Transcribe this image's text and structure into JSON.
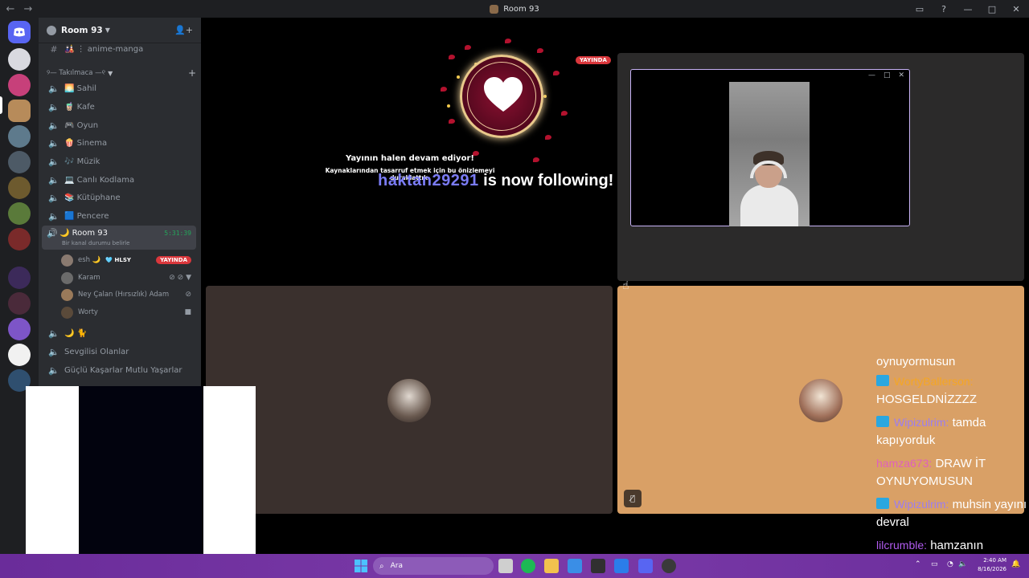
{
  "window": {
    "title": "Room 93",
    "back": "←",
    "forward": "→",
    "controls": {
      "inbox": "▭",
      "help": "?",
      "minimize": "—",
      "maximize": "□",
      "close": "✕"
    }
  },
  "server": {
    "name": "Room 93",
    "top_channel": "🎎 ⋮ anime-manga",
    "category": "୨— Takılmaca —୧",
    "channels": [
      "🌅 Sahil",
      "🧋 Kafe",
      "🎮 Oyun",
      "🍿 Sinema",
      "🎶 Müzik",
      "💻 Canlı Kodlama",
      "📚 Kütüphane",
      "🟦 Pencere"
    ],
    "active_channel": {
      "name": "🌙 Room 93",
      "status": "Bir kanal durumu belirle",
      "timer": "5:31:39"
    },
    "voice_users": [
      {
        "name": "esh 🌙",
        "tag": "🩵 HLSY",
        "badge": "YAYINDA"
      },
      {
        "name": "Karam",
        "icons": "⊘ ⊘ ▼"
      },
      {
        "name": "Ney Çalan (Hırsızlık) Adam",
        "icons": "⊘"
      },
      {
        "name": "Worty",
        "icons": "■"
      }
    ],
    "more_channels": [
      "🌙 🐈",
      "Sevgilisi Olanlar",
      "Güçlü Kaşarlar Mutlu Yaşarlar"
    ]
  },
  "stream": {
    "live_badge": "YAYINDA",
    "paused_title": "Yayının halen devam ediyor!",
    "paused_desc": "Kaynaklarından tasarruf etmek için bu önizlemeyi duraklattık.",
    "follow_user": "haktan29291",
    "follow_text": " is now following!"
  },
  "pip": {
    "minimize": "—",
    "expand": "□",
    "close": "✕"
  },
  "chat": [
    {
      "user": "",
      "text": "oynuyormusun",
      "user_color": "#f5b041"
    },
    {
      "user": "WortyBallerson:",
      "text": "HOSGELDNİZZZZ",
      "user_color": "#f5a623",
      "badge": true
    },
    {
      "user": "Wipizulrim:",
      "text": "tamda kapıyorduk",
      "user_color": "#9b7df2",
      "badge": true
    },
    {
      "user": "hamza673:",
      "text": "DRAW İT OYNUYOMUSUN",
      "user_color": "#e05fbd",
      "badge": false
    },
    {
      "user": "Wipizulrim:",
      "text": "muhsin yayını devral",
      "user_color": "#9b7df2",
      "badge": true
    },
    {
      "user": "lilcrumble:",
      "text": "hamzanın heyecanı",
      "user_color": "#b15bf0",
      "badge": false
    }
  ],
  "taskbar": {
    "search_placeholder": "Ara",
    "time": "2:40 AM",
    "date": "8/16/2026"
  },
  "colors": {
    "accent": "#5865f2",
    "live": "#da373c",
    "online": "#23a55a",
    "follow_name": "#7b7cf5"
  }
}
